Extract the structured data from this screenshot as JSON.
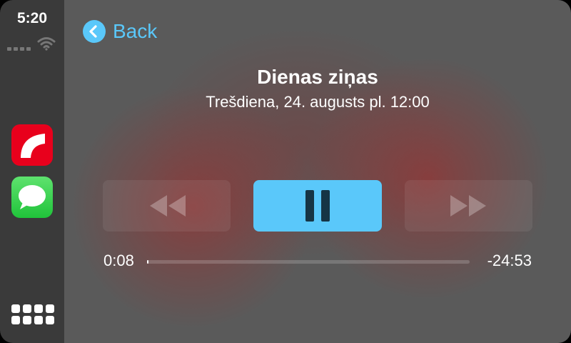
{
  "status_bar": {
    "time": "5:20"
  },
  "sidebar": {
    "apps": [
      {
        "name": "news",
        "icon": "news-app-icon"
      },
      {
        "name": "messages",
        "icon": "messages-app-icon"
      }
    ],
    "home_icon": "app-grid-icon"
  },
  "nav": {
    "back_label": "Back"
  },
  "now_playing": {
    "title": "Dienas ziņas",
    "subtitle": "Trešdiena, 24. augusts pl. 12:00",
    "elapsed": "0:08",
    "remaining": "-24:53",
    "progress_percent": 0.5,
    "state": "playing"
  },
  "colors": {
    "accent": "#5ac8fa",
    "news_red": "#e8001c",
    "messages_green": "#34c759"
  }
}
